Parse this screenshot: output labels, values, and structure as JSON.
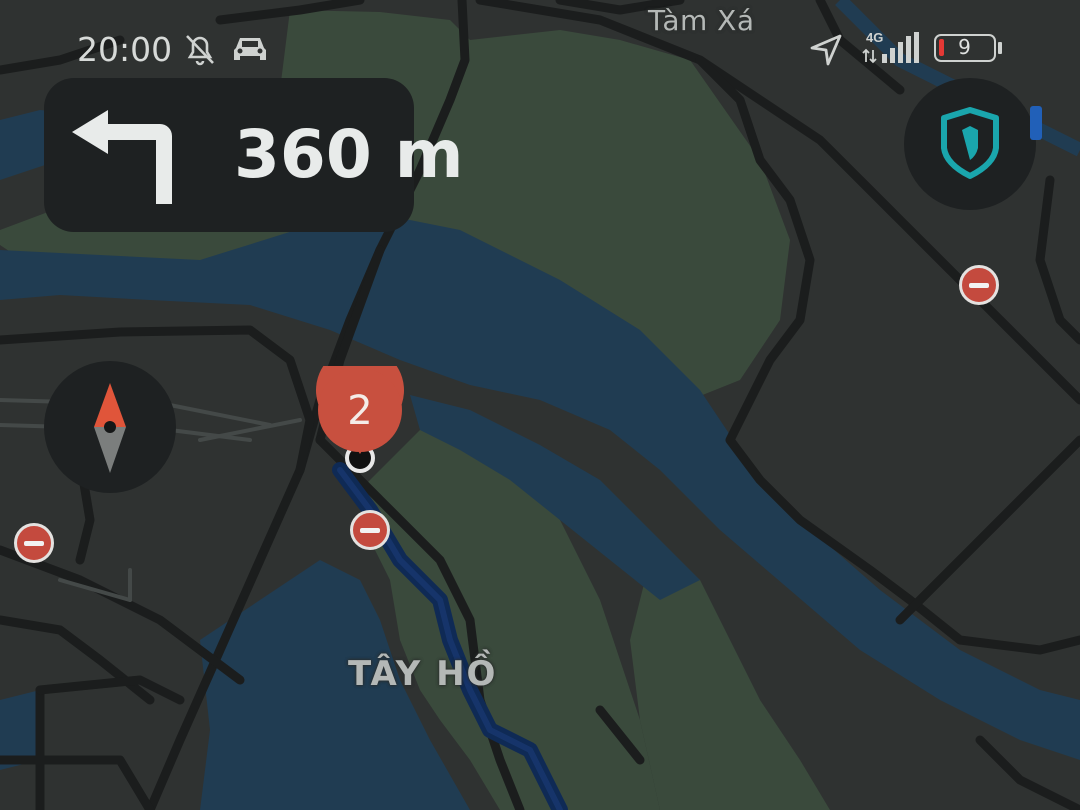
{
  "status_bar": {
    "time": "20:00",
    "network_type": "4G",
    "battery_level": "9",
    "icons": [
      "notifications-off-icon",
      "car-icon",
      "location-arrow-icon",
      "signal-icon",
      "battery-icon"
    ]
  },
  "navigation": {
    "maneuver": "turn-left",
    "distance": "360 m"
  },
  "map": {
    "places": {
      "tam_xa": "Tàm Xá",
      "tay_ho": "TÂY HỒ"
    },
    "waypoint_number": "2"
  },
  "colors": {
    "map_background": "#2f3231",
    "water": "#203c52",
    "park": "#3a4a3c",
    "road": "#1b1d1d",
    "route": "#0f2a55",
    "waypoint": "#c8503f",
    "shield_accent": "#1aa6ad",
    "no_entry": "#c44a3e"
  }
}
